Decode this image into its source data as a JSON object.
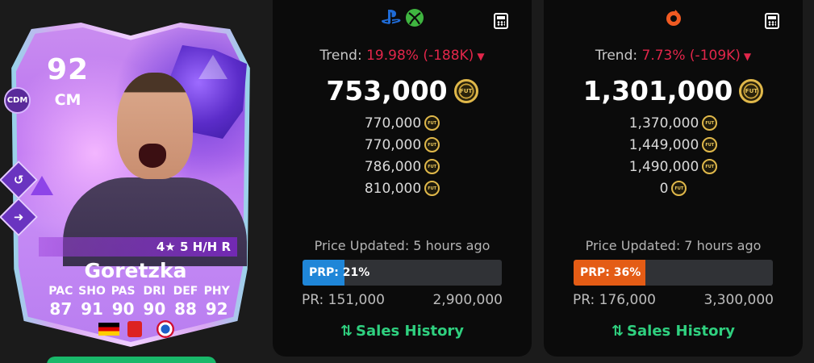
{
  "card": {
    "rating": "92",
    "position": "CM",
    "role_badge": "CDM",
    "skills": "4★ 5 H/H R",
    "name": "Goretzka",
    "stats": [
      {
        "label": "PAC",
        "value": "87"
      },
      {
        "label": "SHO",
        "value": "91"
      },
      {
        "label": "PAS",
        "value": "90"
      },
      {
        "label": "DRI",
        "value": "90"
      },
      {
        "label": "DEF",
        "value": "88"
      },
      {
        "label": "PHY",
        "value": "92"
      }
    ]
  },
  "console_panel": {
    "platform_icons": [
      "playstation-icon",
      "xbox-icon"
    ],
    "trend_label": "Trend:",
    "trend_value": "19.98% (-188K)",
    "main_price": "753,000",
    "prices": [
      "770,000",
      "770,000",
      "786,000",
      "810,000"
    ],
    "updated": "Price Updated: 5 hours ago",
    "prp": "PRP: 21%",
    "prp_percent": 21,
    "pr_min": "PR: 151,000",
    "pr_max": "2,900,000",
    "sales_label": "Sales History",
    "accent": "#1f86d8"
  },
  "pc_panel": {
    "platform_icons": [
      "origin-icon"
    ],
    "trend_label": "Trend:",
    "trend_value": "7.73% (-109K)",
    "main_price": "1,301,000",
    "prices": [
      "1,370,000",
      "1,449,000",
      "1,490,000",
      "0"
    ],
    "updated": "Price Updated: 7 hours ago",
    "prp": "PRP: 36%",
    "prp_percent": 36,
    "pr_min": "PR: 176,000",
    "pr_max": "3,300,000",
    "sales_label": "Sales History",
    "accent": "#e45c15"
  },
  "coin_label": "FUT",
  "colors": {
    "trend_down": "#e2264a",
    "sales_link": "#2fd07f",
    "coin": "#e0b84a"
  }
}
